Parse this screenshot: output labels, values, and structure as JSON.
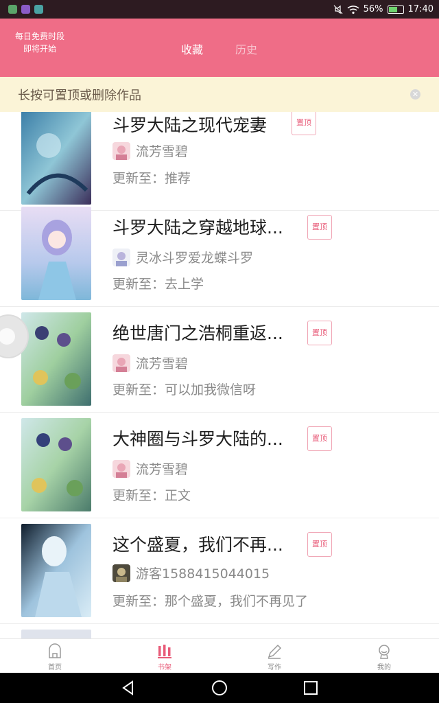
{
  "status_bar": {
    "battery": "56%",
    "battery_level": 0.56,
    "time": "17:40",
    "app_icon_colors": [
      "#5aa469",
      "#8b5cc7",
      "#4aa3a3"
    ]
  },
  "header": {
    "promo_line1": "每日免费时段",
    "promo_line2": "即将开始",
    "tabs": [
      {
        "label": "收藏",
        "active": true
      },
      {
        "label": "历史",
        "active": false
      }
    ],
    "color": "#ef6d87"
  },
  "hint": {
    "text": "长按可置顶或删除作品",
    "close_icon": "close-icon"
  },
  "pin_label": "置顶",
  "books": [
    {
      "title": "斗罗大陆之现代宠妻",
      "author": "流芳雪碧",
      "update": "更新至：推荐"
    },
    {
      "title": "斗罗大陆之穿越地球...",
      "author": "灵冰斗罗爱龙蝶斗罗",
      "update": "更新至：去上学"
    },
    {
      "title": "绝世唐门之浩桐重返...",
      "author": "流芳雪碧",
      "update": "更新至：可以加我微信呀"
    },
    {
      "title": "大神圈与斗罗大陆的...",
      "author": "流芳雪碧",
      "update": "更新至：正文"
    },
    {
      "title": "这个盛夏，我们不再...",
      "author": "游客1588415044015",
      "update": "更新至：那个盛夏，我们不再见了"
    }
  ],
  "bottom_nav": [
    {
      "label": "首页",
      "icon": "home-icon",
      "active": false
    },
    {
      "label": "书架",
      "icon": "bookshelf-icon",
      "active": true
    },
    {
      "label": "写作",
      "icon": "pen-icon",
      "active": false
    },
    {
      "label": "我的",
      "icon": "profile-icon",
      "active": false
    }
  ],
  "accent_color": "#e85b78"
}
